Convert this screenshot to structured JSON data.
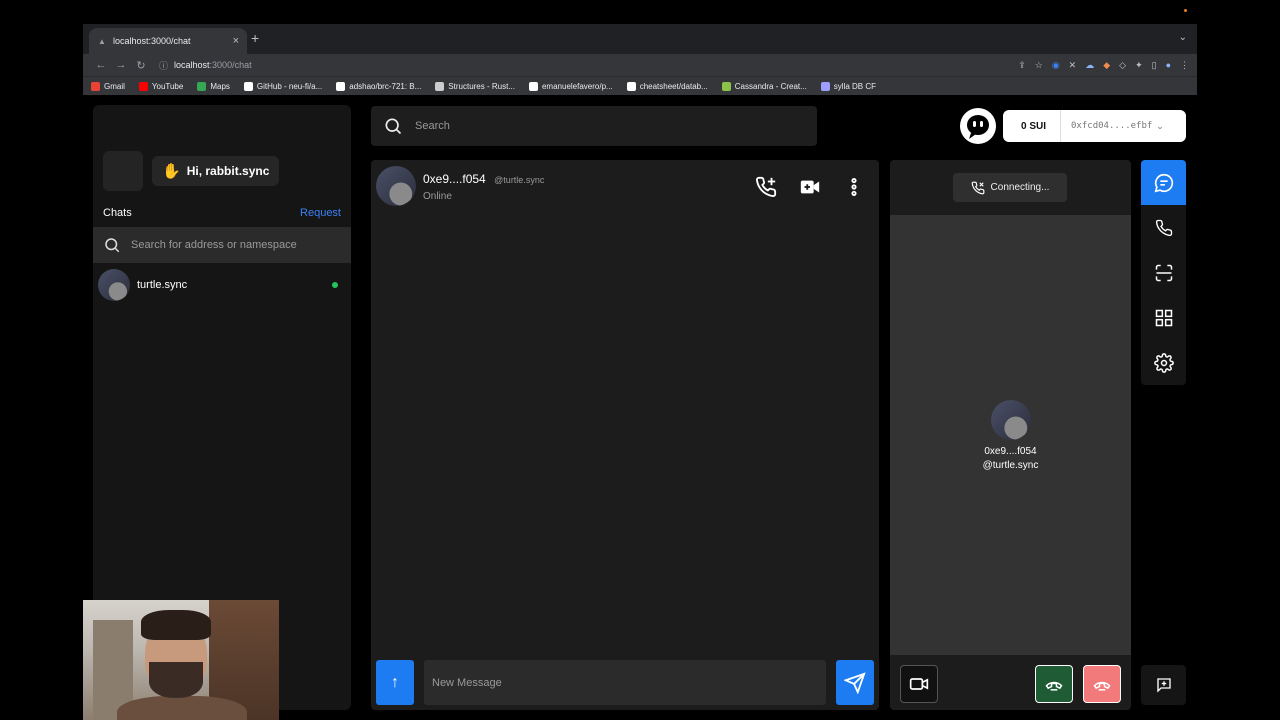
{
  "browser": {
    "tab_title": "localhost:3000/chat",
    "url_host": "localhost",
    "url_path": ":3000/chat",
    "bookmarks": [
      {
        "label": "Gmail",
        "color": "#ea4335"
      },
      {
        "label": "YouTube",
        "color": "#ff0000"
      },
      {
        "label": "Maps",
        "color": "#34a853"
      },
      {
        "label": "GitHub - neu-fi/a...",
        "color": "#ffffff"
      },
      {
        "label": "adshao/brc-721: B...",
        "color": "#ffffff"
      },
      {
        "label": "Structures - Rust...",
        "color": "#cccccc"
      },
      {
        "label": "emanuelefavero/p...",
        "color": "#ffffff"
      },
      {
        "label": "cheatsheet/datab...",
        "color": "#ffffff"
      },
      {
        "label": "Cassandra - Creat...",
        "color": "#8bc34a"
      },
      {
        "label": "sylla DB CF",
        "color": "#9e9eff"
      }
    ]
  },
  "sidebar": {
    "greeting": "Hi, rabbit.sync",
    "chats_label": "Chats",
    "request_label": "Request",
    "search_placeholder": "Search for address or namespace",
    "contacts": [
      {
        "name": "turtle.sync",
        "online": true
      }
    ]
  },
  "topbar": {
    "search_placeholder": "Search",
    "balance": "0 SUI",
    "address": "0xfcd04....efbf"
  },
  "chat": {
    "name": "0xe9....f054",
    "handle": "@turtle.sync",
    "status": "Online",
    "message_placeholder": "New Message"
  },
  "call": {
    "status": "Connecting...",
    "callee_name": "0xe9....f054",
    "callee_handle": "@turtle.sync"
  },
  "colors": {
    "accent": "#1d7cf2",
    "online": "#22c55e",
    "accept": "#1f5c36",
    "decline": "#f27a7a"
  }
}
